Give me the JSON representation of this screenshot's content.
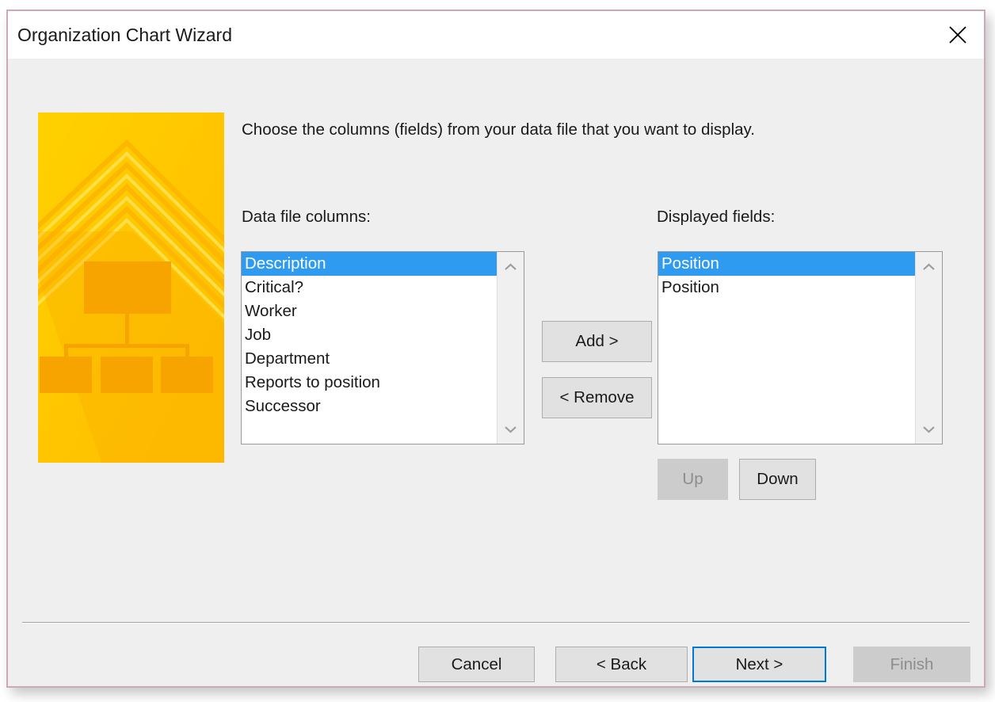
{
  "window": {
    "title": "Organization Chart Wizard",
    "close_icon": "close-icon"
  },
  "main": {
    "instruction": "Choose the columns (fields) from your data file that you want to display.",
    "left_list": {
      "label": "Data file columns:",
      "items": [
        {
          "text": "Description",
          "selected": true
        },
        {
          "text": "Critical?",
          "selected": false
        },
        {
          "text": "Worker",
          "selected": false
        },
        {
          "text": "Job",
          "selected": false
        },
        {
          "text": "Department",
          "selected": false
        },
        {
          "text": "Reports to position",
          "selected": false
        },
        {
          "text": "Successor",
          "selected": false
        }
      ]
    },
    "right_list": {
      "label": "Displayed fields:",
      "items": [
        {
          "text": "Position",
          "selected": true
        },
        {
          "text": "Position",
          "selected": false
        }
      ]
    },
    "transfer_buttons": {
      "add": "Add >",
      "remove": "< Remove"
    },
    "order_buttons": {
      "up": "Up",
      "down": "Down"
    }
  },
  "footer": {
    "cancel": "Cancel",
    "back": "< Back",
    "next": "Next >",
    "finish": "Finish"
  },
  "colors": {
    "selection_blue": "#2f9bf0",
    "focus_blue": "#0078d7",
    "dialog_border": "#cbaab1",
    "dialog_background": "#efefef",
    "button_face": "#e1e1e1",
    "disabled_face": "#cccccc",
    "disabled_text": "#8d8d8d",
    "art_yellow": "#ffc800",
    "art_amber": "#f5a623"
  }
}
